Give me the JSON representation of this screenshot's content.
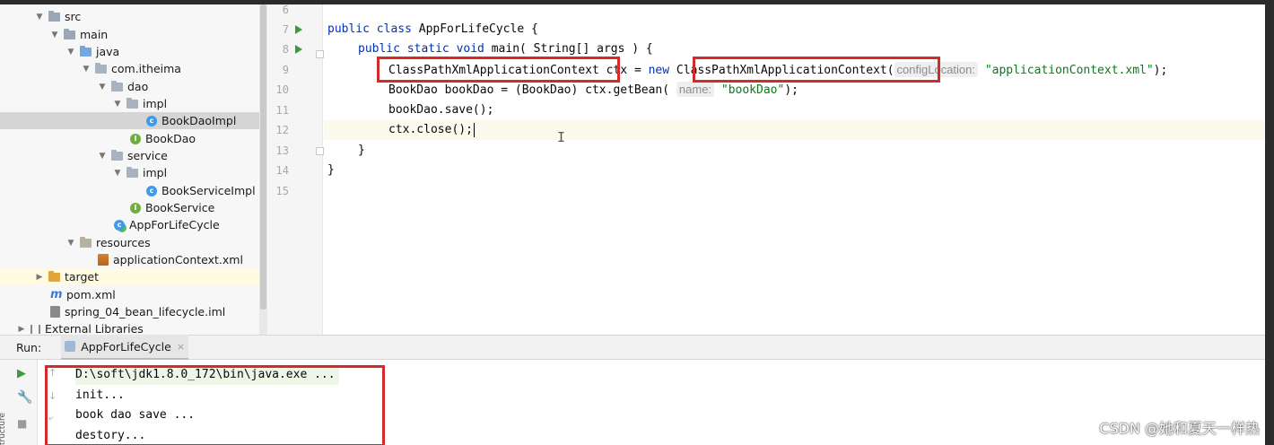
{
  "project_tree": {
    "items": [
      {
        "label": "src"
      },
      {
        "label": "main"
      },
      {
        "label": "java"
      },
      {
        "label": "com.itheima"
      },
      {
        "label": "dao"
      },
      {
        "label": "impl"
      },
      {
        "label": "BookDaoImpl"
      },
      {
        "label": "BookDao"
      },
      {
        "label": "service"
      },
      {
        "label": "impl"
      },
      {
        "label": "BookServiceImpl"
      },
      {
        "label": "BookService"
      },
      {
        "label": "AppForLifeCycle"
      },
      {
        "label": "resources"
      },
      {
        "label": "applicationContext.xml"
      },
      {
        "label": "target"
      },
      {
        "label": "pom.xml"
      },
      {
        "label": "spring_04_bean_lifecycle.iml"
      },
      {
        "label": "External Libraries"
      }
    ],
    "class_badge": "c",
    "interface_badge": "I",
    "maven_badge": "m"
  },
  "editor": {
    "line_numbers": [
      "6",
      "7",
      "8",
      "9",
      "10",
      "11",
      "12",
      "13",
      "14",
      "15"
    ],
    "code": {
      "l7_kw": "public class",
      "l7_rest": " AppForLifeCycle {",
      "l8_kw": "public static void",
      "l8_rest": " main( String[] args ) {",
      "l9_type": "ClassPathXmlApplicationContext",
      "l9_mid": " ctx = ",
      "l9_new": "new",
      "l9_ctor": " ClassPathXmlApplicationContext(",
      "l9_hint": "configLocation:",
      "l9_str": "\"applicationContext.xml\"",
      "l9_end": ");",
      "l10_start": "BookDao bookDao = (BookDao) ctx.getBean(",
      "l10_hint": "name:",
      "l10_str": "\"bookDao\"",
      "l10_end": ");",
      "l11": "bookDao.save();",
      "l12": "ctx.close();",
      "l13": "}",
      "l14": "}"
    }
  },
  "run_panel": {
    "label": "Run:",
    "tab_label": "AppForLifeCycle",
    "tab_close": "×",
    "console_lines": [
      "D:\\soft\\jdk1.8.0_172\\bin\\java.exe ...",
      "init...",
      "book dao save ...",
      "destory..."
    ],
    "side_label": "Structure"
  },
  "watermark": "CSDN @她和夏天一样热",
  "colors": {
    "highlight_box": "#d42a2a",
    "keyword": "#0033b3",
    "string": "#067d17"
  }
}
